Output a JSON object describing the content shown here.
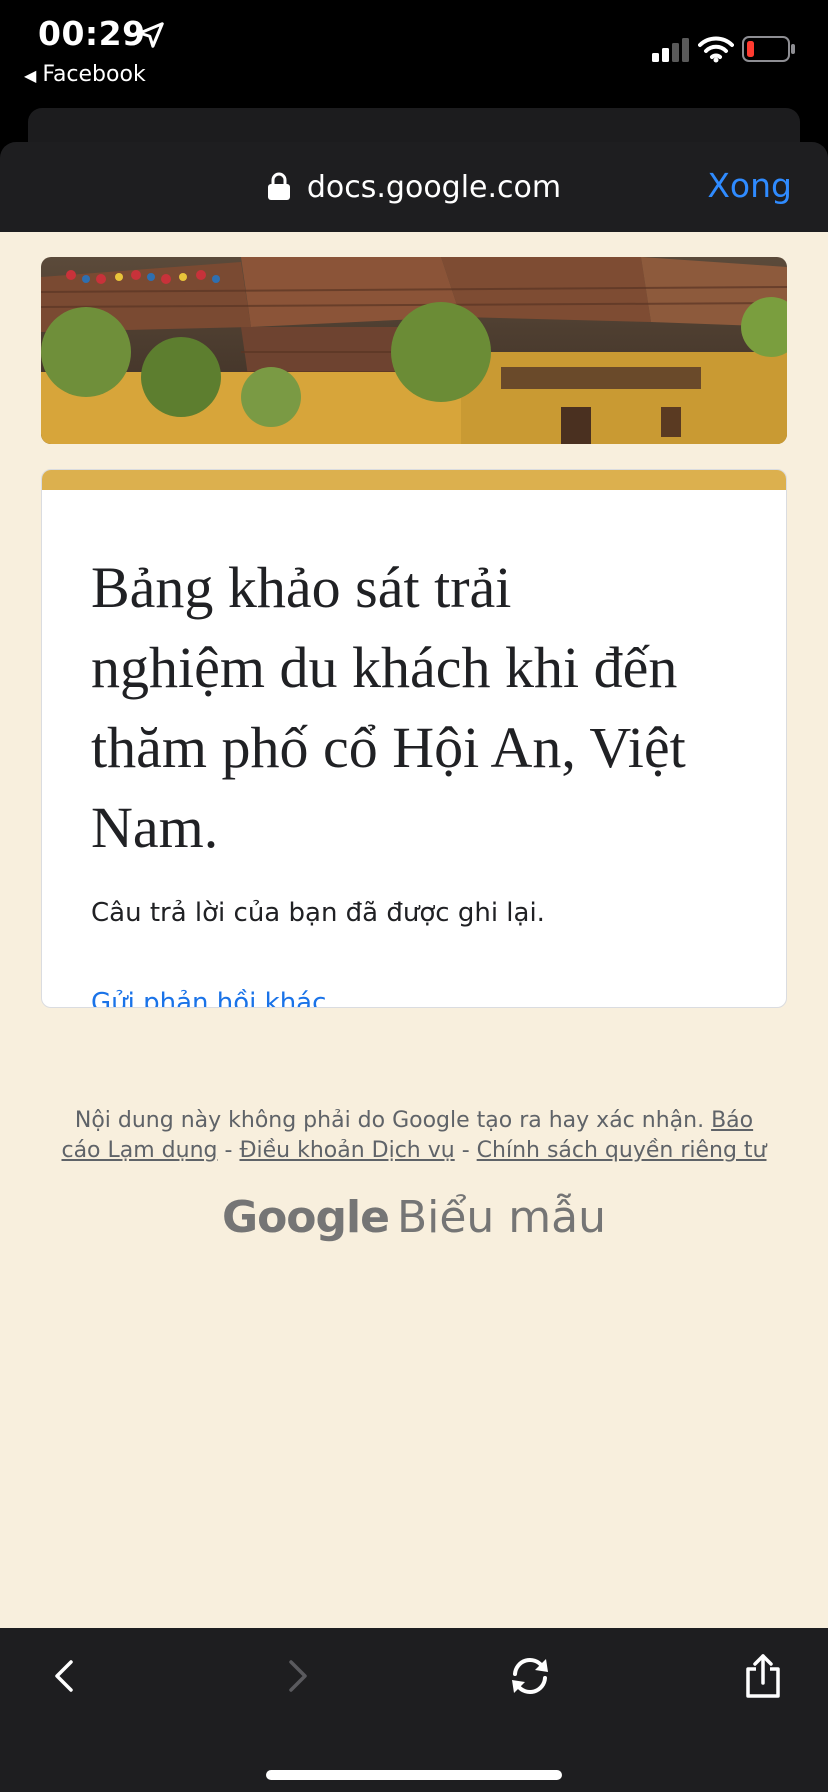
{
  "status_bar": {
    "time": "00:29",
    "back_app": "Facebook",
    "battery_color": "#ff3b30"
  },
  "browser": {
    "url": "docs.google.com",
    "done_label": "Xong",
    "accent": "#2f8bff"
  },
  "form": {
    "title": "Bảng khảo sát trải nghiệm du khách khi đến thăm phố cổ Hội An, Việt Nam.",
    "confirmation": "Câu trả lời của bạn đã được ghi lại.",
    "resubmit_link": "Gửi phản hồi khác",
    "accent_color": "#dcb04e"
  },
  "footer": {
    "disclaimer": "Nội dung này không phải do Google tạo ra hay xác nhận.",
    "links": {
      "report": "Báo cáo Lạm dụng",
      "terms": "Điều khoản Dịch vụ",
      "privacy": "Chính sách quyền riêng tư"
    },
    "separator": "-",
    "brand_google": "Google",
    "brand_product": "Biểu mẫu"
  },
  "toolbar": {
    "icons": [
      "back-icon",
      "forward-icon",
      "reload-icon",
      "share-icon"
    ]
  }
}
